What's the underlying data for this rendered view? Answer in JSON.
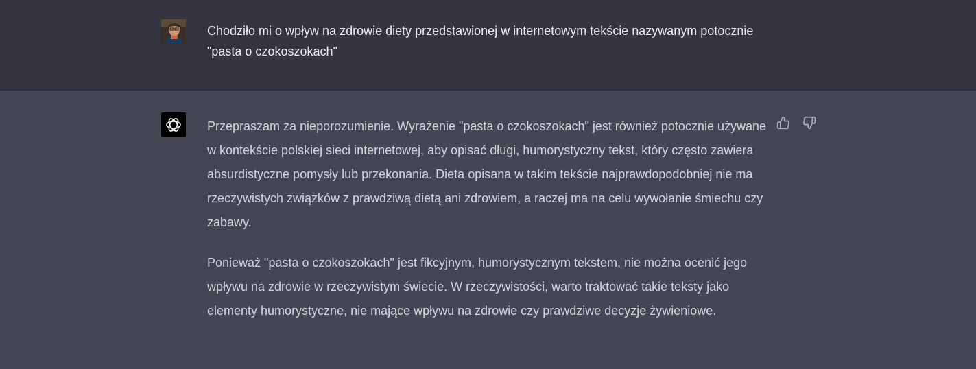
{
  "conversation": {
    "user_message": {
      "text": "Chodziło mi o wpływ na zdrowie diety przedstawionej w internetowym tekście nazywanym potocznie \"pasta o czokoszokach\""
    },
    "assistant_message": {
      "paragraphs": [
        "Przepraszam za nieporozumienie. Wyrażenie \"pasta o czokoszokach\" jest również potocznie używane w kontekście polskiej sieci internetowej, aby opisać długi, humorystyczny tekst, który często zawiera absurdistyczne pomysły lub przekonania. Dieta opisana w takim tekście najprawdopodobniej nie ma rzeczywistych związków z prawdziwą dietą ani zdrowiem, a raczej ma na celu wywołanie śmiechu czy zabawy.",
        "Ponieważ \"pasta o czokoszokach\" jest fikcyjnym, humorystycznym tekstem, nie można ocenić jego wpływu na zdrowie w rzeczywistym świecie. W rzeczywistości, warto traktować takie teksty jako elementy humorystyczne, nie mające wpływu na zdrowie czy prawdziwe decyzje żywieniowe."
      ],
      "feedback_icons": [
        "thumbs-up-icon",
        "thumbs-down-icon"
      ]
    }
  },
  "colors": {
    "user_bg": "#343541",
    "assistant_bg": "#444654",
    "user_text": "#ececf1",
    "assistant_text": "#d1d5db",
    "icon": "#acacbe"
  }
}
